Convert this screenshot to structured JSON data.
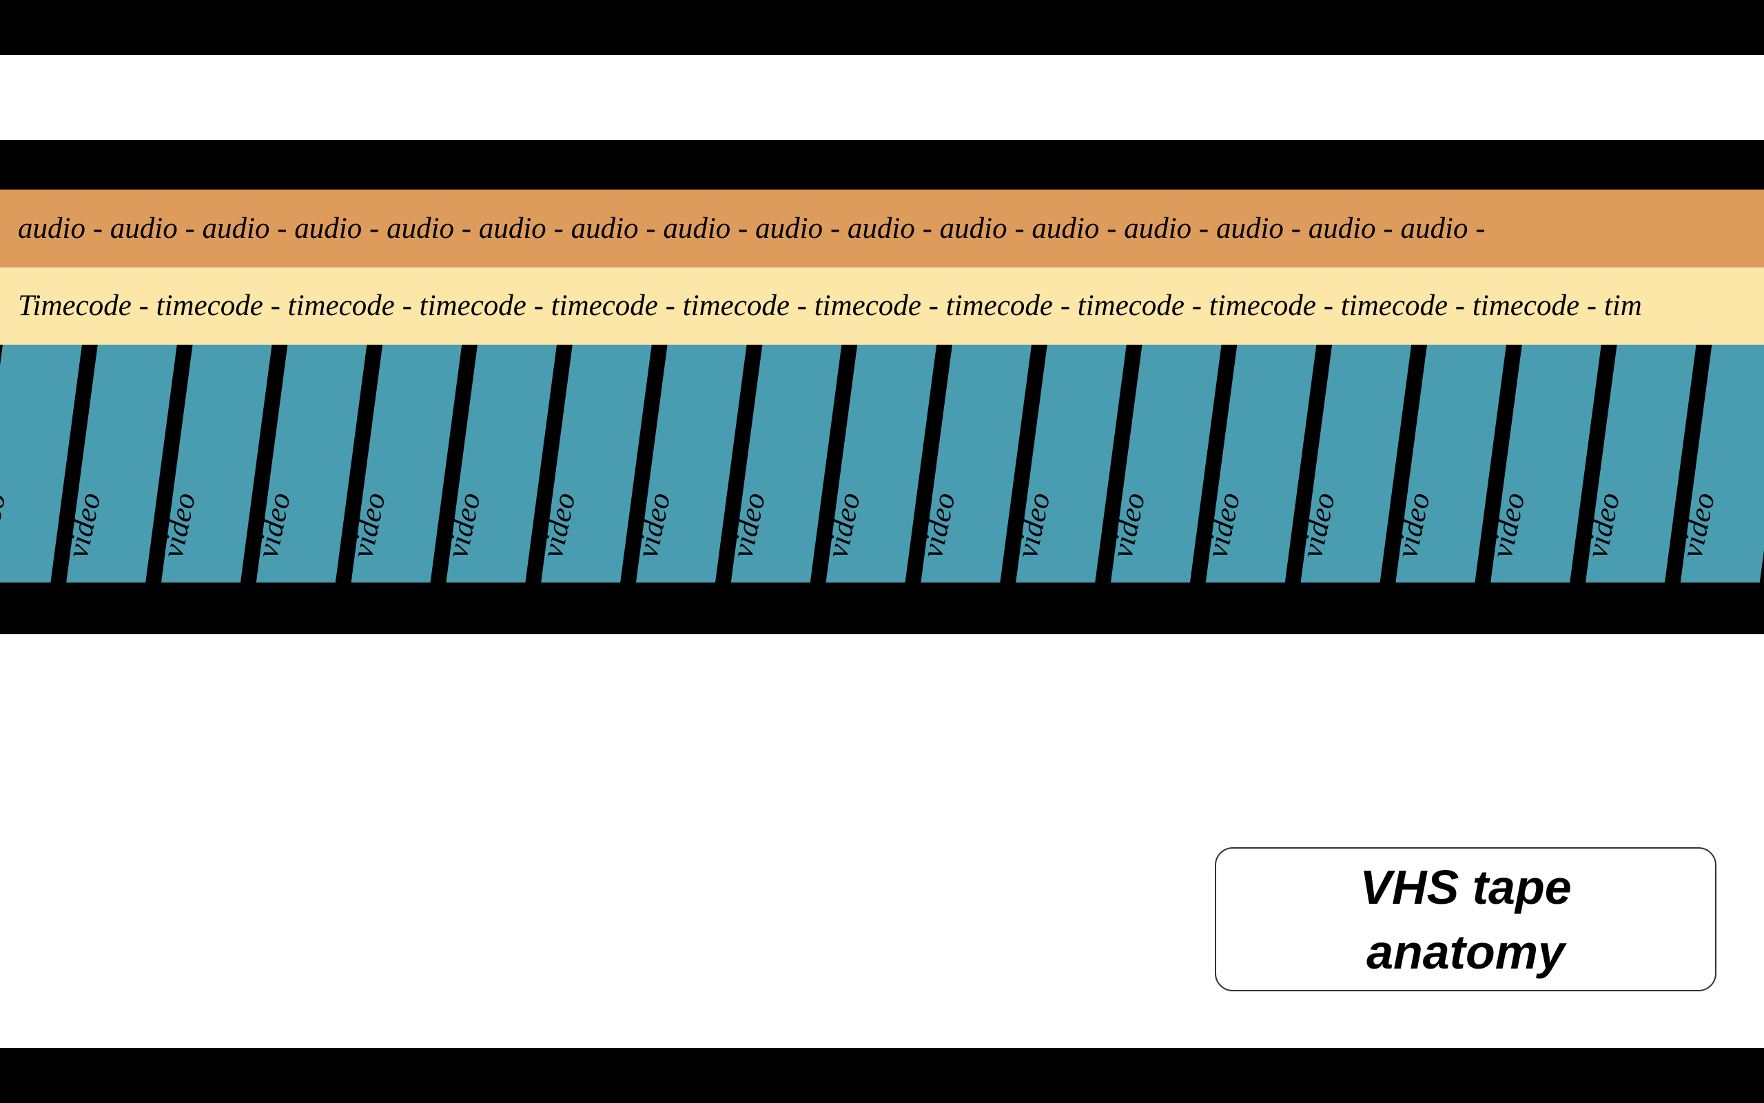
{
  "colors": {
    "audio_track": "#de9c5c",
    "timecode_track": "#fce7a8",
    "video_track": "#4a9db0",
    "tape_edge": "#000000"
  },
  "audio_track": {
    "text": "audio - audio - audio -  audio - audio - audio - audio - audio - audio - audio - audio - audio - audio - audio - audio - audio -"
  },
  "timecode_track": {
    "text": "Timecode - timecode - timecode - timecode - timecode - timecode - timecode - timecode - timecode - timecode - timecode - timecode - tim"
  },
  "video_track": {
    "stripe_label": "video",
    "stripe_count": 19
  },
  "title_box": {
    "line1": "VHS tape",
    "line2": "anatomy"
  }
}
